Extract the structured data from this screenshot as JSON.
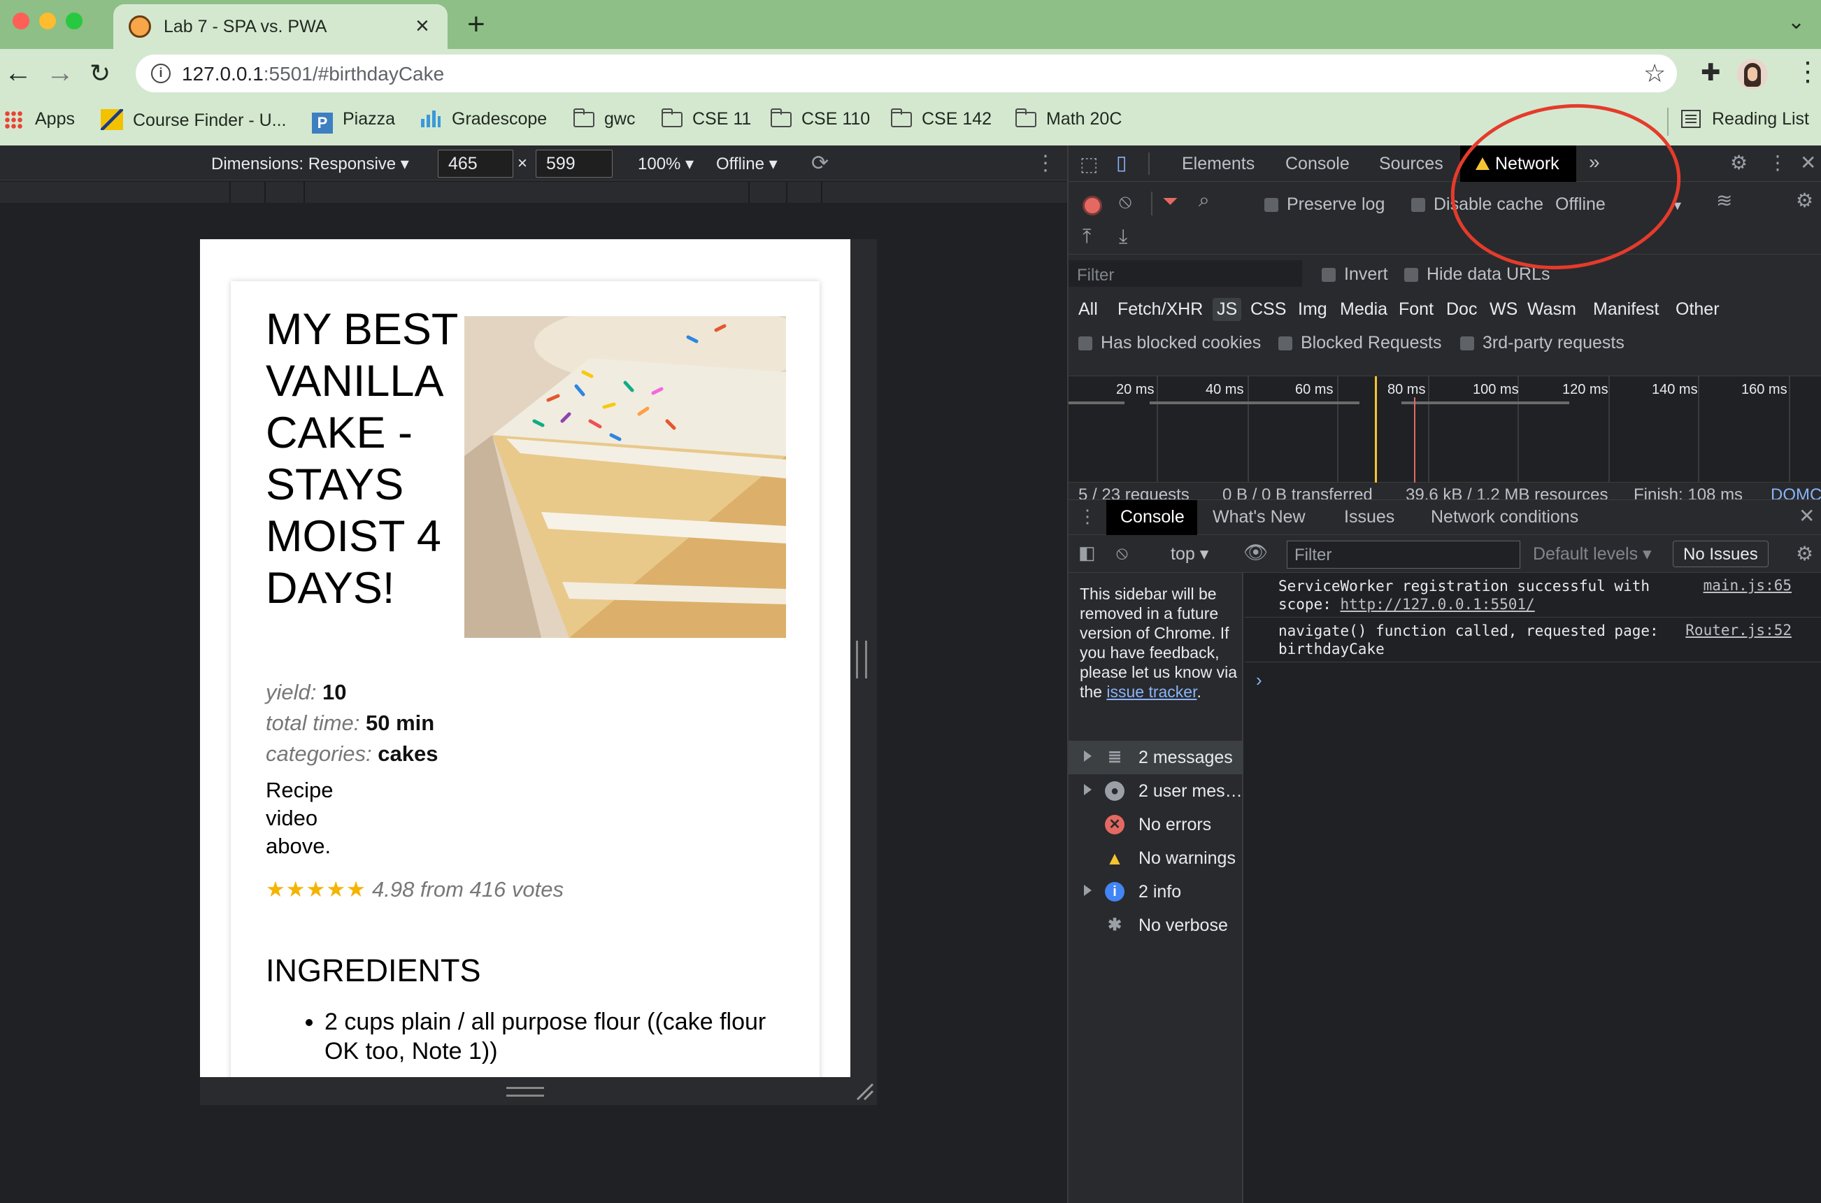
{
  "colors": {
    "tabstrip": "#8dbf86",
    "toolbar": "#d4e8d0",
    "devtools_bg": "#202124",
    "accent_star": "#f4b400",
    "annotation": "#e53b2c"
  },
  "browser": {
    "tab_title": "Lab 7 - SPA vs. PWA",
    "url_host": "127.0.0.1",
    "url_path": ":5501/#birthdayCake"
  },
  "bookmarks": {
    "items": [
      "Apps",
      "Course Finder - U...",
      "Piazza",
      "Gradescope",
      "gwc",
      "CSE 11",
      "CSE 110",
      "CSE 142",
      "Math 20C"
    ],
    "reading_list": "Reading List"
  },
  "device_toolbar": {
    "dimensions_label": "Dimensions: Responsive",
    "width": "465",
    "height": "599",
    "times": "×",
    "zoom": "100%",
    "throttle": "Offline"
  },
  "recipe": {
    "title": "MY BEST VANILLA CAKE - STAYS MOIST 4 DAYS!",
    "yield_key": "yield:",
    "yield_val": "10",
    "time_key": "total time:",
    "time_val": "50 min",
    "cat_key": "categories:",
    "cat_val": "cakes",
    "video_note": "Recipe video above.",
    "stars": "★★★★★",
    "rating_text": "4.98 from 416 votes",
    "rating": 4.98,
    "ingredients_heading": "INGREDIENTS",
    "ingredients": [
      "2 cups plain / all purpose flour ((cake flour OK too, Note 1))"
    ]
  },
  "devtools": {
    "tabs": [
      "Elements",
      "Console",
      "Sources",
      "Network"
    ],
    "active_tab": "Network",
    "network": {
      "preserve_log": "Preserve log",
      "disable_cache": "Disable cache",
      "throttle": "Offline",
      "filter_placeholder": "Filter",
      "invert": "Invert",
      "hide_data_urls": "Hide data URLs",
      "types": [
        "All",
        "Fetch/XHR",
        "JS",
        "CSS",
        "Img",
        "Media",
        "Font",
        "Doc",
        "WS",
        "Wasm",
        "Manifest",
        "Other"
      ],
      "active_type": "JS",
      "has_blocked_cookies": "Has blocked cookies",
      "blocked_requests": "Blocked Requests",
      "third_party": "3rd-party requests",
      "ticks": [
        "20 ms",
        "40 ms",
        "60 ms",
        "80 ms",
        "100 ms",
        "120 ms",
        "140 ms",
        "160 ms"
      ],
      "summary": [
        "5 / 23 requests",
        "0 B / 0 B transferred",
        "39.6 kB / 1.2 MB resources",
        "Finish: 108 ms",
        "DOMC"
      ]
    },
    "drawer": {
      "tabs": [
        "Console",
        "What's New",
        "Issues",
        "Network conditions"
      ],
      "context": "top",
      "filter_placeholder": "Filter",
      "levels": "Default levels",
      "no_issues": "No Issues",
      "sidebar_note": "This sidebar will be removed in a future version of Chrome. If you have feedback, please let us know via the",
      "sidebar_link": "issue tracker",
      "sidebar_period": ".",
      "sidebar_items": [
        "2 messages",
        "2 user mes…",
        "No errors",
        "No warnings",
        "2 info",
        "No verbose"
      ],
      "messages": [
        {
          "text": "ServiceWorker registration successful with scope: ",
          "link": "http://127.0.0.1:5501/",
          "source": "main.js:65"
        },
        {
          "text": "navigate() function called, requested page: birthdayCake",
          "source": "Router.js:52"
        }
      ],
      "prompt": "›"
    }
  }
}
